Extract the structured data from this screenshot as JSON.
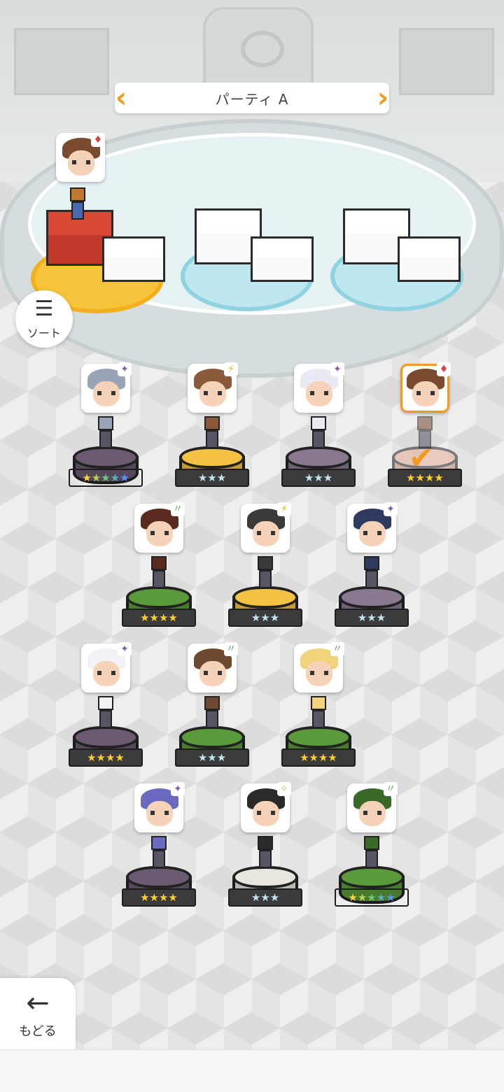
{
  "party": {
    "title": "パーティ A",
    "prev_icon": "chevron-left-icon",
    "next_icon": "chevron-right-icon"
  },
  "sort": {
    "label": "ソート",
    "icon": "sort-icon"
  },
  "back": {
    "label": "もどる",
    "icon": "arrow-left-icon"
  },
  "leader_element": "♦",
  "heroes": [
    {
      "stars": "★★★★★",
      "rank": "rainbow",
      "element": "✦",
      "pedestal": "#6b5a72",
      "hair": "#9aa4b8",
      "selected": false
    },
    {
      "stars": "★★★",
      "rank": "silver",
      "element": "⚡",
      "pedestal": "#f3c143",
      "hair": "#8a5a3a",
      "selected": false
    },
    {
      "stars": "★★★",
      "rank": "silver",
      "element": "✦",
      "pedestal": "#8a7890",
      "hair": "#eaeaf4",
      "selected": false
    },
    {
      "stars": "★★★★",
      "rank": "gold",
      "element": "♦",
      "pedestal": "#e7b09a",
      "hair": "#7a4a2e",
      "selected": true
    },
    {
      "stars": "★★★★",
      "rank": "gold",
      "element": "〃",
      "pedestal": "#5b9a3a",
      "hair": "#5a2a1e",
      "selected": false
    },
    {
      "stars": "★★★",
      "rank": "silver",
      "element": "⚡",
      "pedestal": "#f3c143",
      "hair": "#3a3a3a",
      "selected": false
    },
    {
      "stars": "★★★",
      "rank": "silver",
      "element": "✦",
      "pedestal": "#8a7890",
      "hair": "#2e3a5e",
      "selected": false
    },
    {
      "stars": "★★★★",
      "rank": "gold",
      "element": "✦",
      "pedestal": "#6b5a72",
      "hair": "#f1f1f6",
      "selected": false
    },
    {
      "stars": "★★★",
      "rank": "silver",
      "element": "〃",
      "pedestal": "#5b9a3a",
      "hair": "#6e4a32",
      "selected": false
    },
    {
      "stars": "★★★★",
      "rank": "gold",
      "element": "〃",
      "pedestal": "#5b9a3a",
      "hair": "#f2d27a",
      "selected": false
    },
    {
      "stars": "★★★★",
      "rank": "gold",
      "element": "✦",
      "pedestal": "#6b5a72",
      "hair": "#6a6ac0",
      "selected": false
    },
    {
      "stars": "★★★",
      "rank": "silver",
      "element": "✧",
      "pedestal": "#e8e4de",
      "hair": "#2a2a2a",
      "selected": false
    },
    {
      "stars": "★★★★★",
      "rank": "rainbow",
      "element": "〃",
      "pedestal": "#5b9a3a",
      "hair": "#3a6a2a",
      "selected": false
    }
  ],
  "colors": {
    "accent": "#f39a1a",
    "gold_star": "#ffcf2e",
    "silver_star": "#bfe6f3"
  }
}
